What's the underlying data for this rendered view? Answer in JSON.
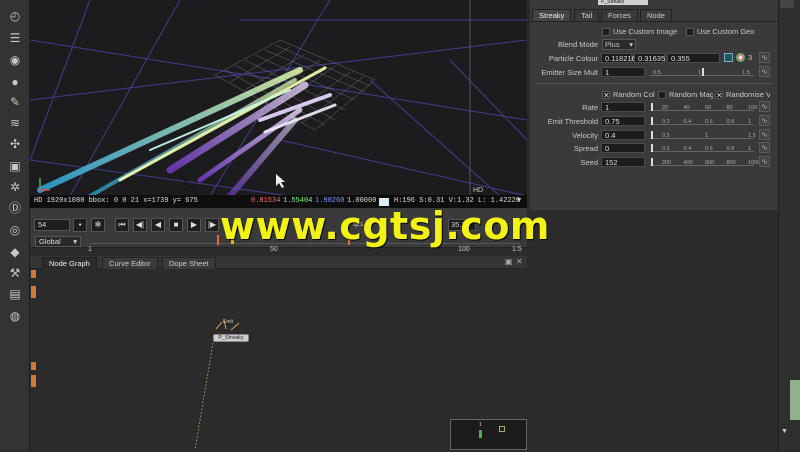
{
  "viewer": {
    "format_label": "HD",
    "info_left": "HD 1920x1080 bbox: 0 0 21 x=1739 y= 675",
    "rgba": [
      "0.81534",
      "1.55404",
      "1.90260",
      "1.00000"
    ],
    "rgba_colors": [
      "#ff6b6b",
      "#7fff7f",
      "#7a9bff",
      "#dddddd"
    ],
    "hsvl": "H:196 S:0.31 V:1.32 L: 1.42220"
  },
  "transport": {
    "frame": "54",
    "range": "Global",
    "fps_label": "fps",
    "end_frame": "35.70",
    "ticks": [
      "1",
      "50",
      "100",
      "1:5"
    ],
    "buttons": [
      "snap-icon",
      "skip-start",
      "prev-key",
      "play-back",
      "stop",
      "play-fwd",
      "next-key",
      "skip-end"
    ]
  },
  "graph_tabs": [
    "Node Graph",
    "Curve Editor",
    "Dope Sheet"
  ],
  "graph": {
    "node_label": "P_Streaky",
    "node_top_label": "Emit",
    "mini_label": "1"
  },
  "props": {
    "node_name": "P_Streaky",
    "tabs": [
      "Streaky",
      "Tail",
      "Forces",
      "Node"
    ],
    "use_custom_image": "Use Custom Image",
    "use_custom_geo": "Use Custom Geo",
    "blend_mode_label": "Blend Mode",
    "blend_mode_value": "Plus",
    "particle_colour_label": "Particle Colour",
    "particle_colour_values": [
      "0.118216",
      "0.31635",
      "0.355"
    ],
    "particle_colour_count": "3",
    "emitter_size_label": "Emitter Size Mult",
    "emitter_size_value": "1",
    "emitter_ticks": [
      "0.5",
      "1",
      "1.5"
    ],
    "random_col": "Random Col",
    "random_mag": "Random Mag",
    "randomise_v": "Randomise V",
    "params": [
      {
        "label": "Rate",
        "value": "1",
        "ticks": [
          "20",
          "40",
          "60",
          "80",
          "100"
        ]
      },
      {
        "label": "Emit Threshold",
        "value": "0.75",
        "ticks": [
          "0.2",
          "0.4",
          "0.6",
          "0.8",
          "1"
        ]
      },
      {
        "label": "Velocity",
        "value": "0.4",
        "ticks": [
          "0.5",
          "1",
          "1.5"
        ]
      },
      {
        "label": "Spread",
        "value": "0",
        "ticks": [
          "0.2",
          "0.4",
          "0.6",
          "0.8",
          "1"
        ]
      },
      {
        "label": "Seed",
        "value": "152",
        "ticks": [
          "200",
          "400",
          "600",
          "800",
          "1000"
        ]
      }
    ]
  },
  "watermark": "www.cgtsj.com",
  "toolbar_icons": [
    "viewer-time-icon",
    "menu-icon",
    "color-icon",
    "sphere-icon",
    "paint-icon",
    "layers-icon",
    "move-icon",
    "cube-icon",
    "particles-icon",
    "deep-icon",
    "eye-icon",
    "tag-icon",
    "wrench-icon",
    "stack-icon",
    "help-icon"
  ]
}
